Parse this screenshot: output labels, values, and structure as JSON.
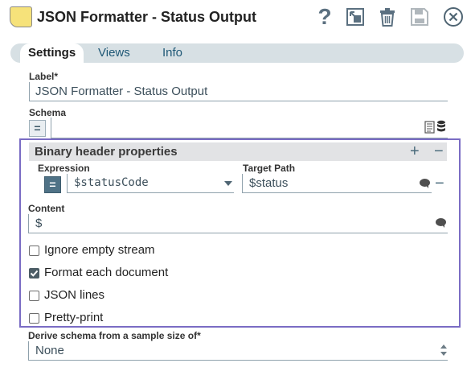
{
  "header": {
    "title": "JSON Formatter - Status Output",
    "help_glyph": "?",
    "icons": [
      "help-icon",
      "export-icon",
      "delete-icon",
      "save-icon",
      "close-icon"
    ],
    "note_color": "#f6e27a"
  },
  "tabs": [
    {
      "label": "Settings",
      "active": true
    },
    {
      "label": "Views",
      "active": false
    },
    {
      "label": "Info",
      "active": false
    }
  ],
  "fields": {
    "label": {
      "title": "Label*",
      "value": "JSON Formatter - Status Output"
    },
    "schema": {
      "title": "Schema",
      "value": "",
      "eq": "="
    }
  },
  "binary_header": {
    "title": "Binary header properties",
    "add": "+",
    "remove": "−",
    "expression": {
      "title": "Expression",
      "value": "$statusCode",
      "eq": "="
    },
    "target_path": {
      "title": "Target Path",
      "value": "$status",
      "remove": "−"
    }
  },
  "content": {
    "title": "Content",
    "value": "$"
  },
  "options": [
    {
      "label": "Ignore empty stream",
      "checked": false
    },
    {
      "label": "Format each document",
      "checked": true
    },
    {
      "label": "JSON lines",
      "checked": false
    },
    {
      "label": "Pretty-print",
      "checked": false
    }
  ],
  "derive_schema": {
    "title": "Derive schema from a sample size of*",
    "value": "None"
  },
  "colors": {
    "accent_border": "#7a6cc4",
    "tab_bar": "#d7e0e4",
    "eq_active": "#4f7286"
  }
}
